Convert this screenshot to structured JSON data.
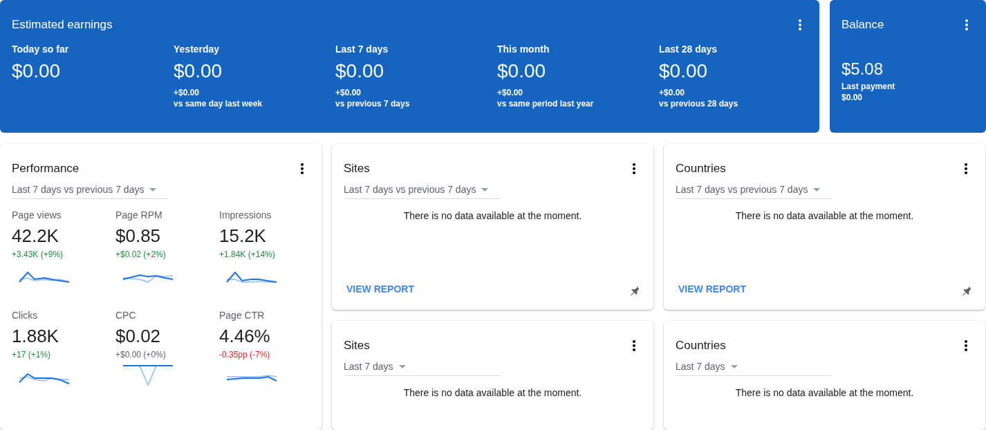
{
  "earnings": {
    "title": "Estimated earnings",
    "periods": [
      {
        "label": "Today so far",
        "value": "$0.00"
      },
      {
        "label": "Yesterday",
        "value": "$0.00",
        "change": "+$0.00",
        "comparison": "vs same day last week"
      },
      {
        "label": "Last 7 days",
        "value": "$0.00",
        "change": "+$0.00",
        "comparison": "vs previous 7 days"
      },
      {
        "label": "This month",
        "value": "$0.00",
        "change": "+$0.00",
        "comparison": "vs same period last year"
      },
      {
        "label": "Last 28 days",
        "value": "$0.00",
        "change": "+$0.00",
        "comparison": "vs previous 28 days"
      }
    ]
  },
  "balance": {
    "title": "Balance",
    "value": "$5.08",
    "last_payment_label": "Last payment",
    "last_payment_value": "$0.00"
  },
  "performance": {
    "title": "Performance",
    "range": "Last 7 days vs previous 7 days",
    "metrics": [
      {
        "label": "Page views",
        "value": "42.2K",
        "change": "+3.43K (+9%)",
        "color": "#1e8e3e"
      },
      {
        "label": "Page RPM",
        "value": "$0.85",
        "change": "+$0.02 (+2%)",
        "color": "#1e8e3e"
      },
      {
        "label": "Impressions",
        "value": "15.2K",
        "change": "+1.84K (+14%)",
        "color": "#1e8e3e"
      },
      {
        "label": "Clicks",
        "value": "1.88K",
        "change": "+17 (+1%)",
        "color": "#1e8e3e"
      },
      {
        "label": "CPC",
        "value": "$0.02",
        "change": "+$0.00 (+0%)",
        "color": "#5f6368"
      },
      {
        "label": "Page CTR",
        "value": "4.46%",
        "change": "-0.35pp (-7%)",
        "color": "#d93025"
      }
    ]
  },
  "reports": [
    {
      "title": "Sites",
      "range": "Last 7 days vs previous 7 days",
      "message": "There is no data available at the moment.",
      "link": "VIEW REPORT"
    },
    {
      "title": "Countries",
      "range": "Last 7 days vs previous 7 days",
      "message": "There is no data available at the moment.",
      "link": "VIEW REPORT"
    },
    {
      "title": "Sites",
      "range": "Last 7 days",
      "message": "There is no data available at the moment."
    },
    {
      "title": "Countries",
      "range": "Last 7 days",
      "message": "There is no data available at the moment."
    }
  ]
}
